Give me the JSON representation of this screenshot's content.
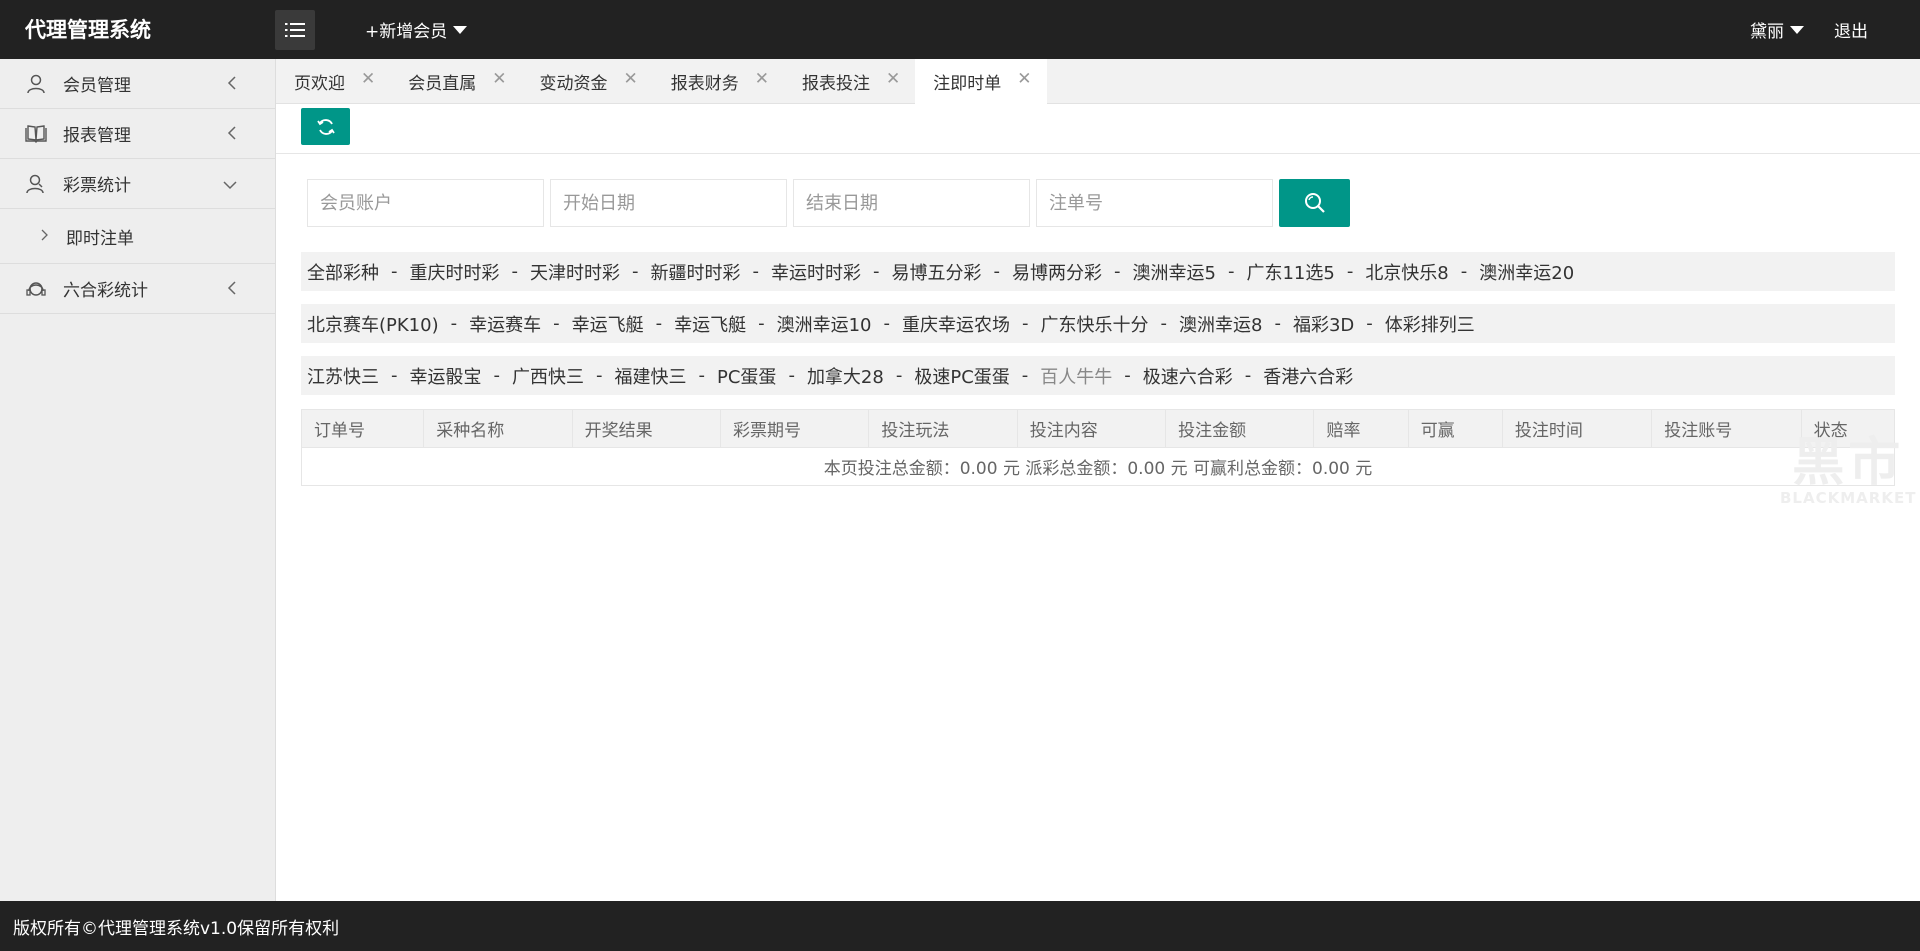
{
  "header": {
    "title": "代理管理系统",
    "add_member": "+新增会员",
    "user_name": "黛丽",
    "logout": "退出"
  },
  "sidebar": {
    "items": [
      {
        "label": "会员管理",
        "icon": "user-icon"
      },
      {
        "label": "报表管理",
        "icon": "book-icon"
      },
      {
        "label": "彩票统计",
        "icon": "user-group-icon",
        "expanded": true,
        "children": [
          {
            "label": "即时注单"
          }
        ]
      },
      {
        "label": "六合彩统计",
        "icon": "headset-icon"
      }
    ]
  },
  "tabs": [
    {
      "label": "页欢迎",
      "close": "✕"
    },
    {
      "label": "会员直属",
      "close": "✕"
    },
    {
      "label": "变动资金",
      "close": "✕"
    },
    {
      "label": "报表财务",
      "close": "✕"
    },
    {
      "label": "报表投注",
      "close": "✕"
    },
    {
      "label": "注即时单",
      "close": "✕",
      "active": true
    }
  ],
  "search": {
    "member_placeholder": "会员账户",
    "start_placeholder": "开始日期",
    "end_placeholder": "结束日期",
    "order_placeholder": "注单号"
  },
  "lottery_rows": [
    [
      "全部彩种",
      "重庆时时彩",
      "天津时时彩",
      "新疆时时彩",
      "幸运时时彩",
      "易博五分彩",
      "易博两分彩",
      "澳洲幸运5",
      "广东11选5",
      "北京快乐8",
      "澳洲幸运20"
    ],
    [
      "北京赛车(PK10)",
      "幸运赛车",
      "幸运飞艇",
      "幸运飞艇",
      "澳洲幸运10",
      "重庆幸运农场",
      "广东快乐十分",
      "澳洲幸运8",
      "福彩3D",
      "体彩排列三"
    ],
    [
      "江苏快三",
      "幸运骰宝",
      "广西快三",
      "福建快三",
      "PC蛋蛋",
      "加拿大28",
      "极速PC蛋蛋",
      "百人牛牛",
      "极速六合彩",
      "香港六合彩"
    ]
  ],
  "lottery_separator": "-",
  "table": {
    "headers": [
      "订单号",
      "采种名称",
      "开奖结果",
      "彩票期号",
      "投注玩法",
      "投注内容",
      "投注金额",
      "赔率",
      "可赢",
      "投注时间",
      "投注账号",
      "状态"
    ],
    "summary": "本页投注总金额：0.00 元  派彩总金额：0.00 元  可赢利总金额：0.00 元"
  },
  "watermark": {
    "big": "黑市",
    "small": "BLACKMARKET"
  },
  "footer": {
    "text": "版权所有©代理管理系统v1.0保留所有权利"
  },
  "colors": {
    "accent": "#009688",
    "header_bg": "#222222",
    "sidebar_bg": "#eeeeee"
  }
}
